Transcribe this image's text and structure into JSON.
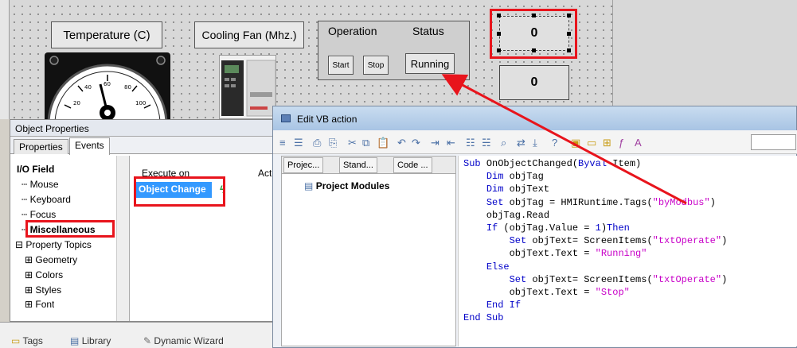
{
  "canvas": {
    "temperature_label": "Temperature (C)",
    "fan_label": "Cooling Fan (Mhz.)",
    "operation_title": "Operation",
    "status_title": "Status",
    "start_label": "Start",
    "stop_label": "Stop",
    "status_value": "Running",
    "io_top_value": "0",
    "io_bottom_value": "0"
  },
  "object_properties": {
    "title": "Object Properties",
    "tabs": [
      "Properties",
      "Events"
    ],
    "tree": {
      "root": "I/O Field",
      "items": [
        "Mouse",
        "Keyboard",
        "Focus",
        "Miscellaneous"
      ],
      "property_topics": "Property Topics",
      "subitems": [
        "Geometry",
        "Colors",
        "Styles",
        "Font"
      ]
    },
    "events": {
      "header_execute": "Execute on",
      "header_action": "Act",
      "row": "Object Change"
    }
  },
  "bottom_tabs": [
    "Tags",
    "Library",
    "Dynamic Wizard"
  ],
  "vb_editor": {
    "title": "Edit VB action",
    "left_tabs": [
      "Projec...",
      "Stand...",
      "Code ..."
    ],
    "module_label": "Project Modules",
    "code": [
      [
        {
          "t": "Sub ",
          "c": "kw"
        },
        {
          "t": "OnObjectChanged(",
          "c": ""
        },
        {
          "t": "Byval",
          "c": "kw"
        },
        {
          "t": " Item)",
          "c": ""
        }
      ],
      [
        {
          "t": "    ",
          "c": ""
        },
        {
          "t": "Dim",
          "c": "kw"
        },
        {
          "t": " objTag",
          "c": ""
        }
      ],
      [
        {
          "t": "    ",
          "c": ""
        },
        {
          "t": "Dim",
          "c": "kw"
        },
        {
          "t": " objText",
          "c": ""
        }
      ],
      [
        {
          "t": "    ",
          "c": ""
        },
        {
          "t": "Set",
          "c": "kw"
        },
        {
          "t": " objTag = HMIRuntime.Tags(",
          "c": ""
        },
        {
          "t": "\"byModbus\"",
          "c": "str"
        },
        {
          "t": ")",
          "c": ""
        }
      ],
      [
        {
          "t": "    objTag.Read",
          "c": ""
        }
      ],
      [
        {
          "t": "    ",
          "c": ""
        },
        {
          "t": "If",
          "c": "kw"
        },
        {
          "t": " (objTag.Value = ",
          "c": ""
        },
        {
          "t": "1",
          "c": "num"
        },
        {
          "t": ")",
          "c": ""
        },
        {
          "t": "Then",
          "c": "kw"
        }
      ],
      [
        {
          "t": "        ",
          "c": ""
        },
        {
          "t": "Set",
          "c": "kw"
        },
        {
          "t": " objText= ScreenItems(",
          "c": ""
        },
        {
          "t": "\"txtOperate\"",
          "c": "str"
        },
        {
          "t": ")",
          "c": ""
        }
      ],
      [
        {
          "t": "        objText.Text = ",
          "c": ""
        },
        {
          "t": "\"Running\"",
          "c": "str"
        }
      ],
      [
        {
          "t": "    ",
          "c": ""
        },
        {
          "t": "Else",
          "c": "kw"
        }
      ],
      [
        {
          "t": "        ",
          "c": ""
        },
        {
          "t": "Set",
          "c": "kw"
        },
        {
          "t": " objText= ScreenItems(",
          "c": ""
        },
        {
          "t": "\"txtOperate\"",
          "c": "str"
        },
        {
          "t": ")",
          "c": ""
        }
      ],
      [
        {
          "t": "        objText.Text = ",
          "c": ""
        },
        {
          "t": "\"Stop\"",
          "c": "str"
        }
      ],
      [
        {
          "t": "    ",
          "c": ""
        },
        {
          "t": "End If",
          "c": "kw"
        }
      ],
      [
        {
          "t": "End Sub",
          "c": "kw"
        }
      ]
    ]
  },
  "colors": {
    "highlight": "#e8141c",
    "selection": "#3399ff",
    "keyword": "#0000c8",
    "string": "#c800c8"
  }
}
